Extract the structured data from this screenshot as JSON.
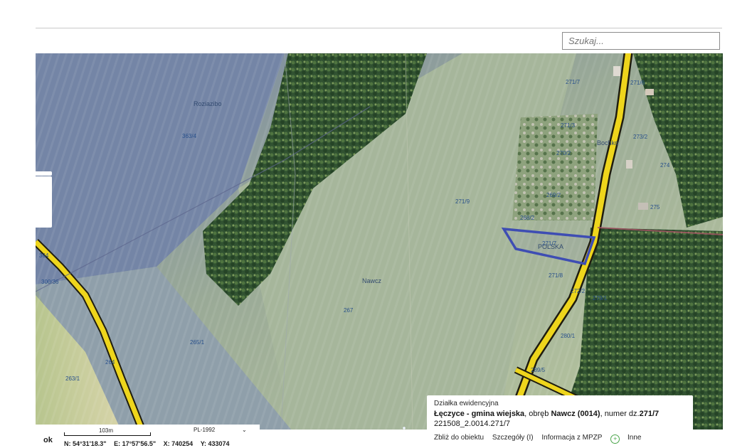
{
  "search": {
    "placeholder": "Szukaj..."
  },
  "map": {
    "labels": {
      "roziazibo": "Roziazibo",
      "nawcz": "Nawcz",
      "bochko": "Bochko",
      "polska": "POLSKA"
    },
    "parcels": {
      "p363_4": "363/4",
      "p364": "364",
      "p300_36": "300/36",
      "p265_1": "265/1",
      "p263_1": "263/1",
      "p264": "264",
      "p267": "267",
      "p271_9": "271/9",
      "p271_7a": "271/7",
      "p271_7b": "271/7",
      "p271_8": "271/8",
      "p271_6": "271/6",
      "p271_3": "271/3",
      "p270_2": "270/2",
      "p269_2": "269/2",
      "p268_2": "268/2",
      "p273_2": "273/2",
      "p274": "274",
      "p275": "275",
      "p272_2": "272/2",
      "p279_1": "279/1",
      "p280_1": "280/1",
      "p289_5": "289/5"
    },
    "colors": {
      "field_light": "#b7c79e",
      "field_dark": "#7c88a6",
      "forest": "#2f4a2b",
      "road": "#e9d21b",
      "selection": "#3e4db3"
    }
  },
  "controls": {
    "ok_label": "ok",
    "scale_label": "103m",
    "crs_value": "PL-1992",
    "coords": {
      "n": "N: 54°31'18.3\"",
      "e": "E: 17°57'56.5\"",
      "x": "X: 740254",
      "y": "Y: 433074"
    }
  },
  "popup": {
    "title": "Działka ewidencyjna",
    "municipality": "Łęczyce - gmina wiejska",
    "precinct_prefix": ", obręb ",
    "precinct_bold": "Nawcz (0014)",
    "number_prefix": ", numer dz.",
    "parcel_number": "271/7",
    "identifier": "221508_2.0014.271/7",
    "actions": {
      "zoom": "Zbliż do obiektu",
      "details": "Szczegóły (I)",
      "mpzp": "Informacja z MPZP",
      "other": "Inne"
    }
  }
}
